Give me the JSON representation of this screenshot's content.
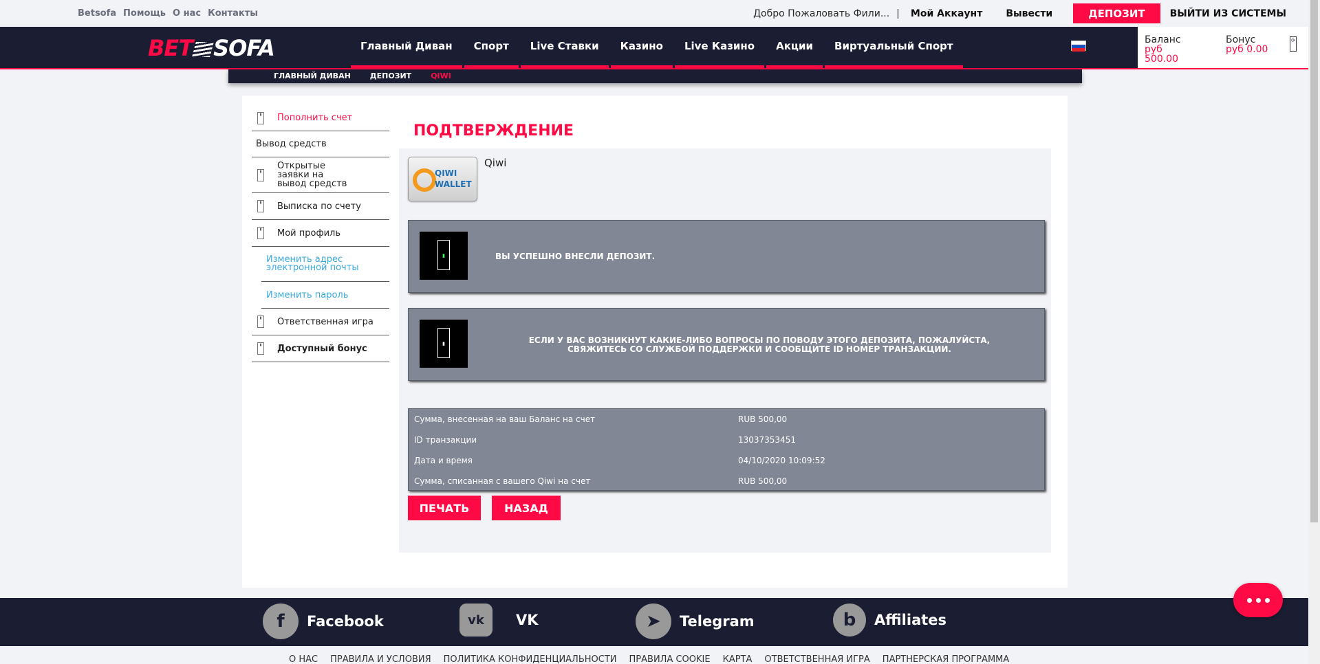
{
  "topbar": {
    "links": [
      "Betsofa",
      "Помощь",
      "О нас",
      "Контакты"
    ],
    "welcome": "Добро Пожаловать Фили...",
    "separator": "|",
    "my_account": "Мой Аккаунт",
    "withdraw": "Вывести",
    "deposit": "ДЕПОЗИТ",
    "logout": "ВЫЙТИ ИЗ СИСТЕМЫ"
  },
  "logo": {
    "bet": "BET",
    "sofa": "SOFA"
  },
  "nav": {
    "items": [
      "Главный Диван",
      "Спорт",
      "Live Ставки",
      "Казино",
      "Live Казино",
      "Акции",
      "Виртуальный Спорт"
    ]
  },
  "balance": {
    "balance_label": "Баланс",
    "balance_currency": "руб",
    "balance_value": "500.00",
    "bonus_label": "Бонус",
    "bonus_value": "руб 0.00"
  },
  "breadcrumb": [
    "ГЛАВНЫЙ ДИВАН",
    "ДЕПОЗИТ",
    "QIWI"
  ],
  "sidebar": {
    "items": [
      "Пополнить счет",
      "Вывод средств",
      "Открытые заявки на вывод средств",
      "Выписка по счету",
      "Мой профиль",
      "Изменить адрес электронной почты",
      "Изменить пароль",
      "Ответственная игра",
      "Доступный бонус"
    ]
  },
  "main": {
    "title": "ПОДТВЕРЖДЕНИЕ",
    "payment_name": "Qiwi",
    "qiwi_logo_text": "QIWI WALLET",
    "success_msg": "ВЫ УСПЕШНО ВНЕСЛИ ДЕПОЗИТ.",
    "info_msg": "ЕСЛИ У ВАС ВОЗНИКНУТ КАКИЕ-ЛИБО ВОПРОСЫ ПО ПОВОДУ ЭТОГО ДЕПОЗИТА, ПОЖАЛУЙСТА, СВЯЖИТЕСЬ СО СЛУЖБОЙ ПОДДЕРЖКИ И СООБЩИТЕ ID НОМЕР ТРАНЗАКЦИИ.",
    "details": [
      {
        "label": "Сумма, внесенная на ваш Баланс на счет",
        "value": "RUB 500,00"
      },
      {
        "label": "ID транзакции",
        "value": "13037353451"
      },
      {
        "label": "Дата и время",
        "value": "04/10/2020 10:09:52"
      },
      {
        "label": "Сумма, списанная с вашего Qiwi на счет",
        "value": "RUB 500,00"
      }
    ],
    "print_button": "ПЕЧАТЬ",
    "back_button": "НАЗАД"
  },
  "footer": {
    "social": [
      "Facebook",
      "VK",
      "Telegram",
      "Affiliates"
    ],
    "links": [
      "О НАС",
      "ПРАВИЛА И УСЛОВИЯ",
      "ПОЛИТИКА КОНФИДЕНЦИАЛЬНОСТИ",
      "ПРАВИЛА COOKIE",
      "КАРТА",
      "ОТВЕТСТВЕННАЯ ИГРА",
      "ПАРТНЕРСКАЯ ПРОГРАММА"
    ]
  },
  "colors": {
    "accent": "#ff0a45",
    "navy": "#1b1e33",
    "panel_gray": "#818795",
    "link_blue": "#3aa9e0"
  }
}
